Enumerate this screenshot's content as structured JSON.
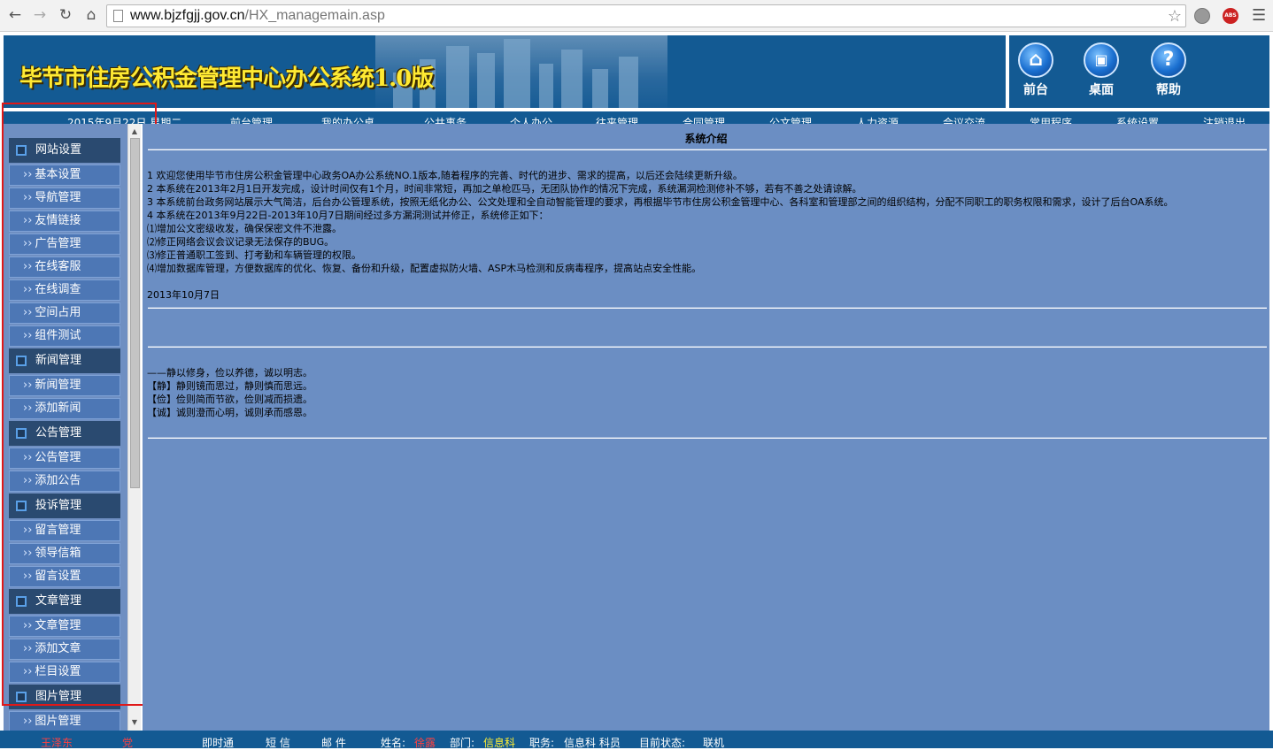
{
  "browser": {
    "url_host": "www.bjzfgjj.gov.cn",
    "url_path": "/HX_managemain.asp"
  },
  "header": {
    "title": "毕节市住房公积金管理中心办公系统1.0版",
    "quick_buttons": [
      {
        "label": "前台",
        "icon": "home-icon"
      },
      {
        "label": "桌面",
        "icon": "desktop-icon"
      },
      {
        "label": "帮助",
        "icon": "help-icon"
      }
    ]
  },
  "topnav": {
    "date": "2015年9月22日 星期二",
    "items": [
      "前台管理",
      "我的办公桌",
      "公共事务",
      "个人办公",
      "往来管理",
      "合同管理",
      "公文管理",
      "人力资源",
      "会议交流",
      "常用程序",
      "系统设置",
      "注销退出"
    ]
  },
  "sidebar": {
    "groups": [
      {
        "label": "网站设置",
        "items": [
          "基本设置",
          "导航管理",
          "友情链接",
          "广告管理",
          "在线客服",
          "在线调查",
          "空间占用",
          "组件测试"
        ]
      },
      {
        "label": "新闻管理",
        "items": [
          "新闻管理",
          "添加新闻"
        ]
      },
      {
        "label": "公告管理",
        "items": [
          "公告管理",
          "添加公告"
        ]
      },
      {
        "label": "投诉管理",
        "items": [
          "留言管理",
          "领导信箱",
          "留言设置"
        ]
      },
      {
        "label": "文章管理",
        "items": [
          "文章管理",
          "添加文章",
          "栏目设置"
        ]
      },
      {
        "label": "图片管理",
        "items": [
          "图片管理"
        ]
      }
    ],
    "arrow": "››"
  },
  "main": {
    "title": "系统介绍",
    "intro_lines": [
      "1 欢迎您使用毕节市住房公积金管理中心政务OA办公系统NO.1版本,随着程序的完善、时代的进步、需求的提高，以后还会陆续更新升级。",
      "2 本系统在2013年2月1日开发完成，设计时间仅有1个月，时间非常短，再加之单枪匹马，无团队协作的情况下完成，系统漏洞检测修补不够，若有不善之处请谅解。",
      "3 本系统前台政务网站展示大气简洁，后台办公管理系统，按照无纸化办公、公文处理和全自动智能管理的要求，再根据毕节市住房公积金管理中心、各科室和管理部之间的组织结构，分配不同职工的职务权限和需求，设计了后台OA系统。",
      "4 本系统在2013年9月22日-2013年10月7日期间经过多方漏洞测试并修正，系统修正如下：",
      "⑴增加公文密级收发，确保保密文件不泄露。",
      "⑵修正网络会议会议记录无法保存的BUG。",
      "⑶修正普通职工签到、打考勤和车辆管理的权限。",
      "⑷增加数据库管理，方便数据库的优化、恢复、备份和升级，配置虚拟防火墙、ASP木马检测和反病毒程序，提高站点安全性能。"
    ],
    "date": "2013年10月7日",
    "motto_lines": [
      "——静以修身，俭以养德，诚以明志。",
      "【静】静则镜而思过，静则慎而思远。",
      "【俭】俭则简而节欲，俭则减而损遗。",
      "【诚】诚则澄而心明，诚则承而感恩。"
    ]
  },
  "statusbar": {
    "left_user": "王泽东",
    "party": "党",
    "chat": "即时通",
    "sms": "短 信",
    "mail": "邮 件",
    "name_label": "姓名:",
    "name_value": "徐露",
    "dept_label": "部门:",
    "dept_value": "信息科",
    "position_label": "职务:",
    "position_value": "信息科 科员",
    "state_label": "目前状态:",
    "state_value": "联机"
  }
}
